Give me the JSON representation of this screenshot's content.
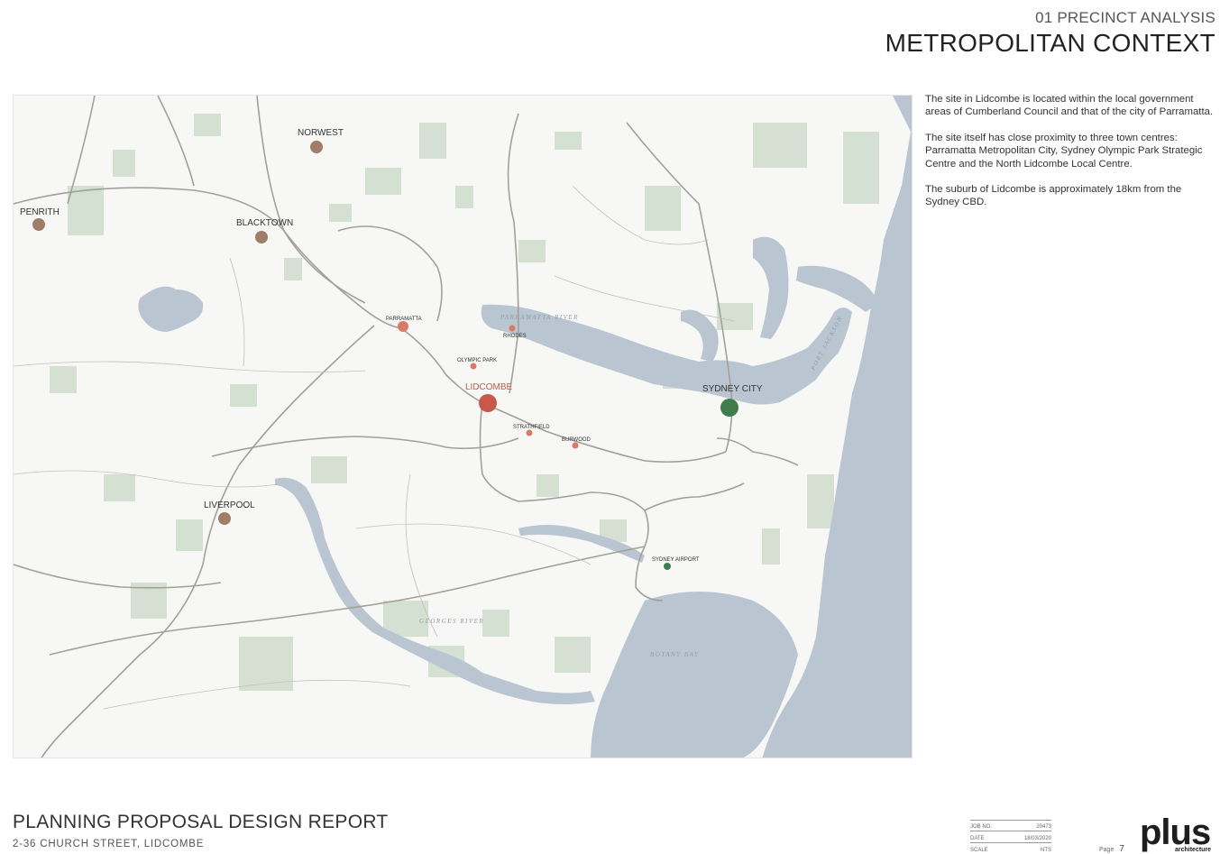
{
  "header": {
    "section": "01 PRECINCT ANALYSIS",
    "title": "METROPOLITAN CONTEXT"
  },
  "description": [
    "The site in Lidcombe is located within the local government areas of Cumberland Council and that of the city of Parramatta.",
    "The site itself has close proximity to three town centres: Parramatta Metropolitan City, Sydney Olympic Park Strategic Centre and the North Lidcombe Local Centre.",
    "The suburb of Lidcombe is approximately 18km from the Sydney CBD."
  ],
  "map": {
    "colors": {
      "water": "#b9c6d1",
      "green": "#cfdccb",
      "road": "#a3a09b",
      "regional": "#a07d68",
      "local": "#d97a66",
      "site": "#c9584a",
      "cbd": "#3f7d4d"
    },
    "places": {
      "norwest": "NORWEST",
      "penrith": "PENRITH",
      "blacktown": "BLACKTOWN",
      "liverpool": "LIVERPOOL",
      "parramatta": "PARRAMATTA",
      "rhodes": "RHODES",
      "olympic_park": "OLYMPIC PARK",
      "lidcombe": "LIDCOMBE",
      "strathfield": "STRATHFIELD",
      "burwood": "BURWOOD",
      "sydney_city": "SYDNEY CITY",
      "sydney_airport": "SYDNEY AIRPORT"
    },
    "water_labels": {
      "parramatta_river": "PARRAMATTA RIVER",
      "georges_river": "GEORGES RIVER",
      "botany_bay": "BOTANY BAY",
      "port_jackson": "PORT JACKSON"
    }
  },
  "footer": {
    "title": "PLANNING PROPOSAL DESIGN REPORT",
    "subtitle": "2-36 CHURCH STREET, LIDCOMBE",
    "job_label": "JOB NO.",
    "job_value": "20473",
    "date_label": "DATE",
    "date_value": "18/03/2020",
    "scale_label": "SCALE",
    "scale_value": "NTS",
    "page_label": "Page",
    "page_value": "7",
    "logo": "plus",
    "logo_sub": "architecture"
  }
}
